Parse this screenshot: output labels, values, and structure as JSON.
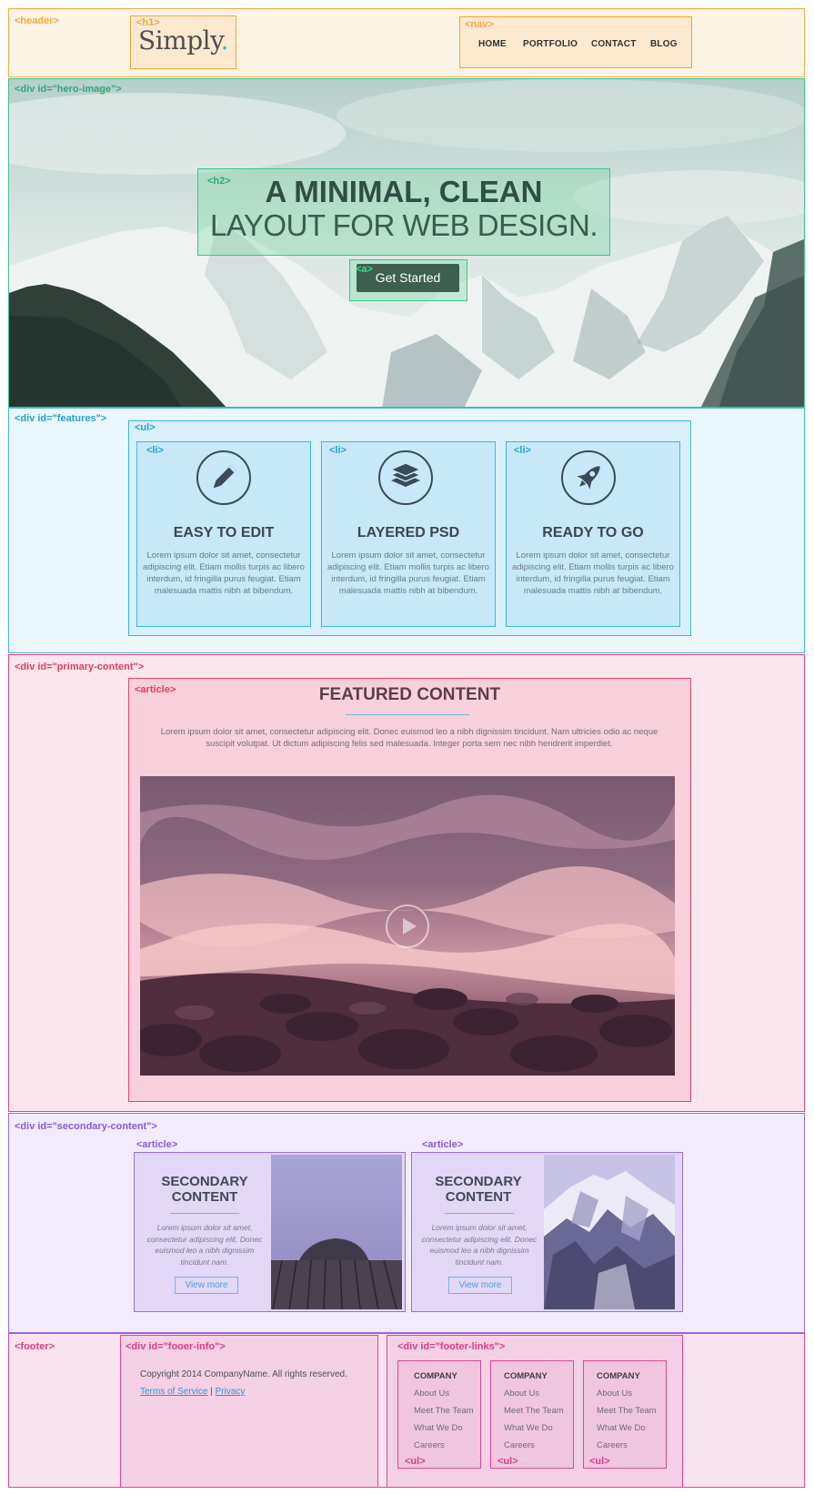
{
  "labels": {
    "header": "<header>",
    "h1": "<h1>",
    "nav": "<nav>",
    "hero": "<div id=\"hero-image\">",
    "h2": "<h2>",
    "a": "<a>",
    "features": "<div id=\"features\">",
    "ul": "<ul>",
    "li": "<li>",
    "primary": "<div id=\"primary-content\">",
    "article": "<article>",
    "secondary": "<div id=\"secondary-content\">",
    "footer": "<footer>",
    "footer_info": "<div id=\"fooer-info\">",
    "footer_links": "<div id=\"footer-links\">"
  },
  "colors": {
    "header": "#f3a742",
    "hero": "#3ec38d",
    "features": "#3ab5e6",
    "primary": "#e8456c",
    "secondary": "#9a6ae6",
    "footer": "#e0469b",
    "accent_dot": "#2fbcc4"
  },
  "header": {
    "logo_text": "Simply",
    "logo_dot": ".",
    "nav": [
      "HOME",
      "PORTFOLIO",
      "CONTACT",
      "BLOG"
    ]
  },
  "hero": {
    "title_line1": "A MINIMAL, CLEAN",
    "title_line2": "LAYOUT FOR WEB DESIGN.",
    "button": "Get Started"
  },
  "features": {
    "items": [
      {
        "icon": "pencil-icon",
        "title": "EASY TO EDIT",
        "text": "Lorem ipsum dolor sit amet, consectetur adipiscing elit. Etiam mollis turpis ac libero interdum, id fringilla purus feugiat. Etiam malesuada mattis nibh at bibendum."
      },
      {
        "icon": "layers-icon",
        "title": "LAYERED PSD",
        "text": "Lorem ipsum dolor sit amet, consectetur adipiscing elit. Etiam mollis turpis ac libero interdum, id fringilla purus feugiat. Etiam malesuada mattis nibh at bibendum."
      },
      {
        "icon": "rocket-icon",
        "title": "READY TO GO",
        "text": "Lorem ipsum dolor sit amet, consectetur adipiscing elit. Etiam mollis turpis ac libero interdum, id fringilla purus feugiat. Etiam malesuada mattis nibh at bibendum."
      }
    ]
  },
  "primary": {
    "title": "FEATURED CONTENT",
    "text": "Lorem ipsum dolor sit amet, consectetur adipiscing elit. Donec euismod leo a nibh dignissim tincidunt. Nam ultricies odio ac neque suscipit volutpat. Ut dictum adipiscing felis sed malesuada. Integer porta sem nec nibh hendrerit imperdiet."
  },
  "secondary": {
    "articles": [
      {
        "title": "SECONDARY CONTENT",
        "text": "Lorem ipsum dolor sit amet, consectetur adipiscing elit. Donec euismod leo a nibh dignissim tincidunt nam.",
        "button": "View more"
      },
      {
        "title": "SECONDARY CONTENT",
        "text": "Lorem ipsum dolor sit amet, consectetur adipiscing elit. Donec euismod leo a nibh dignissim tincidunt nam.",
        "button": "View more"
      }
    ]
  },
  "footer": {
    "copyright": "Copyright 2014 CompanyName. All rights reserved.",
    "terms": "Terms of Service",
    "separator": "|",
    "privacy": "Privacy",
    "columns": [
      {
        "heading": "COMPANY",
        "links": [
          "About Us",
          "Meet The Team",
          "What We Do",
          "Careers"
        ]
      },
      {
        "heading": "COMPANY",
        "links": [
          "About Us",
          "Meet The Team",
          "What We Do",
          "Careers"
        ]
      },
      {
        "heading": "COMPANY",
        "links": [
          "About Us",
          "Meet The Team",
          "What We Do",
          "Careers"
        ]
      }
    ]
  }
}
